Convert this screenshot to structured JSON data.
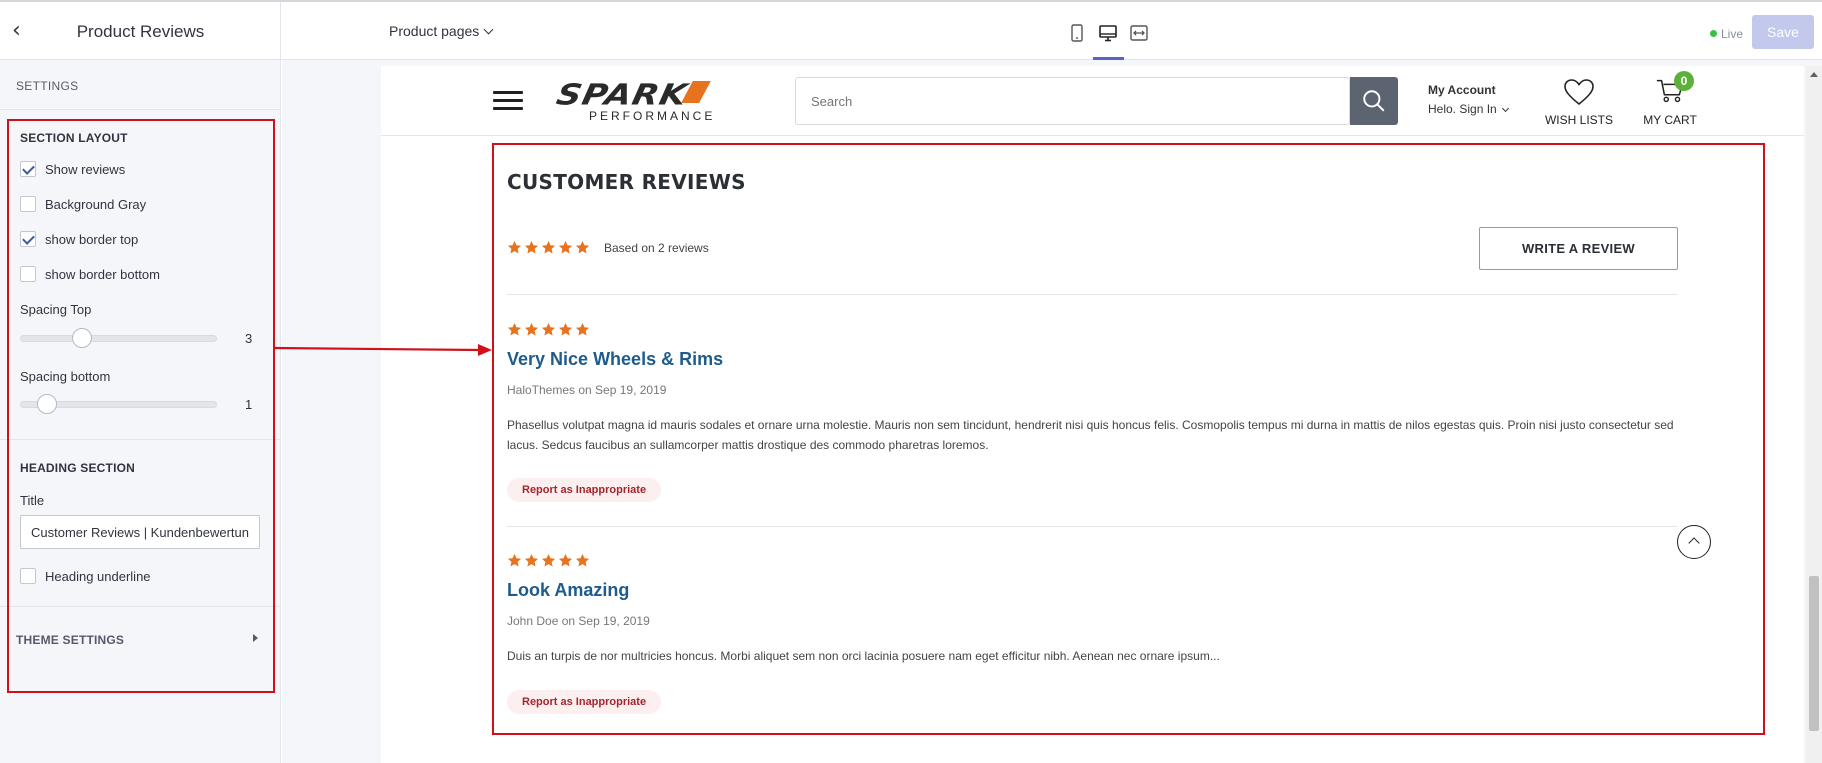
{
  "topbar": {
    "panel_title": "Product Reviews",
    "page_selector": "Product pages",
    "live_label": "Live",
    "save_label": "Save",
    "devices": [
      "mobile-icon",
      "desktop-icon",
      "fullwidth-icon"
    ],
    "active_device": "desktop"
  },
  "panel": {
    "settings_label": "SETTINGS",
    "section_layout": {
      "heading": "SECTION LAYOUT",
      "show_reviews": {
        "label": "Show reviews",
        "checked": true
      },
      "background_gray": {
        "label": "Background Gray",
        "checked": false
      },
      "show_border_top": {
        "label": "show border top",
        "checked": true
      },
      "show_border_bottom": {
        "label": "show border bottom",
        "checked": false
      },
      "spacing_top": {
        "label": "Spacing Top",
        "value": "3"
      },
      "spacing_bottom": {
        "label": "Spacing bottom",
        "value": "1"
      }
    },
    "heading_section": {
      "heading": "HEADING SECTION",
      "title_label": "Title",
      "title_value": "Customer Reviews | Kundenbewertungen",
      "heading_underline": {
        "label": "Heading underline",
        "checked": false
      }
    },
    "theme_settings": "THEME SETTINGS"
  },
  "store": {
    "logo_text": "SPARK",
    "logo_subtext": "PERFORMANCE",
    "search_placeholder": "Search",
    "account_title": "My Account",
    "account_sign": "Helo. Sign In",
    "wishlist_label": "WISH LISTS",
    "cart_label": "MY CART",
    "cart_count": "0"
  },
  "reviews": {
    "title": "CUSTOMER REVIEWS",
    "summary_rating": 5,
    "based_on": "Based on 2 reviews",
    "write_review": "WRITE A REVIEW",
    "items": [
      {
        "rating": 5,
        "title": "Very Nice Wheels & Rims",
        "meta": "HaloThemes on Sep 19, 2019",
        "body": "Phasellus volutpat magna id mauris sodales et ornare urna molestie. Mauris non sem tincidunt, hendrerit nisi quis honcus felis. Cosmopolis tempus mi durna in mattis de nilos egestas quis. Proin nisi justo consectetur sed lacus. Sedcus faucibus an sullamcorper mattis drostique des commodo pharetras loremos.",
        "report": "Report as Inappropriate"
      },
      {
        "rating": 5,
        "title": "Look Amazing",
        "meta": "John Doe on Sep 19, 2019",
        "body": "Duis an turpis de nor multricies honcus. Morbi aliquet sem non orci lacinia posuere nam eget efficitur nibh. Aenean nec ornare ipsum...",
        "report": "Report as Inappropriate"
      }
    ]
  },
  "colors": {
    "star": "#e8731f",
    "review_title": "#1f5b8c",
    "annotation": "#d0111c",
    "save_disabled": "#c3c8ed",
    "live_dot": "#3cbf47",
    "cart_badge": "#5bb13a"
  }
}
